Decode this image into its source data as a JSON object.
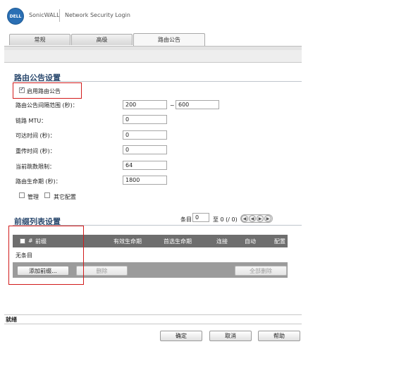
{
  "header": {
    "logo_text": "DELL",
    "brand": "SonicWALL",
    "title": "Network Security Login"
  },
  "tabs": [
    {
      "label": "常规"
    },
    {
      "label": "高级"
    },
    {
      "label": "路由公告"
    }
  ],
  "routing": {
    "section_title": "路由公告设置",
    "enable_label": "启用路由公告",
    "enable_checked": true,
    "interval_label": "路由公告间隔范围 (秒)：",
    "interval_min": "200",
    "interval_sep": "~",
    "interval_max": "600",
    "mtu_label": "链路 MTU：",
    "mtu_value": "0",
    "reachable_label": "可达时间 (秒)：",
    "reachable_value": "0",
    "retrans_label": "重传时间 (秒)：",
    "retrans_value": "0",
    "hoplimit_label": "当前跳数限制：",
    "hoplimit_value": "64",
    "lifetime_label": "路由生命期 (秒)：",
    "lifetime_value": "1800",
    "managed_label": "管理",
    "other_label": "其它配置"
  },
  "prefix": {
    "section_title": "前缀列表设置",
    "pager_label": "条目",
    "pager_value": "0",
    "pager_to": "至 0 (/ 0)",
    "columns": [
      "#",
      "前缀",
      "有效生命期",
      "首选生命期",
      "连接",
      "自动",
      "配置"
    ],
    "empty_text": "无条目",
    "add_button": "添加前缀...",
    "delete_button": "删除",
    "delete_all_button": "全部删除"
  },
  "status": {
    "text": "就绪"
  },
  "footer": {
    "ok": "确定",
    "cancel": "取消",
    "help": "帮助"
  }
}
